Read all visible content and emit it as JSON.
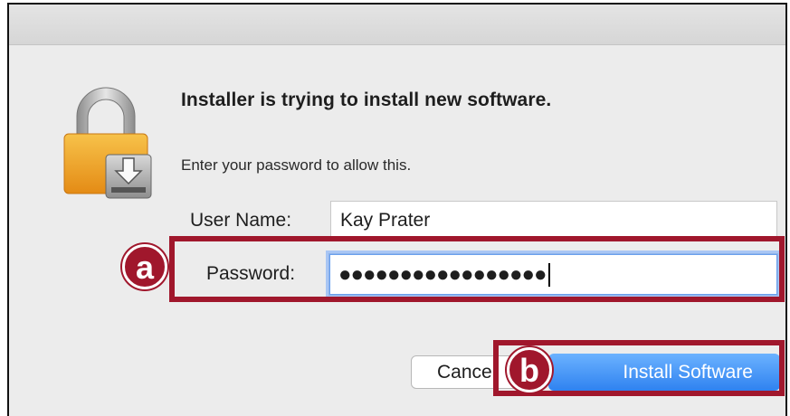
{
  "dialog": {
    "heading": "Installer is trying to install new software.",
    "message": "Enter your password to allow this."
  },
  "form": {
    "username_label": "User Name:",
    "username_value": "Kay Prater",
    "password_label": "Password:",
    "password_mask": "●●●●●●●●●●●●●●●●●"
  },
  "buttons": {
    "cancel_label": "Cancel",
    "install_label": "Install Software"
  },
  "annotations": {
    "badge_a": "a",
    "badge_b": "b"
  },
  "icons": {
    "dialog_icon": "lock-installer-icon"
  },
  "colors": {
    "annotation": "#a0172c",
    "primary_button": "#2f82f0",
    "focus_ring": "#a9c6f4"
  }
}
